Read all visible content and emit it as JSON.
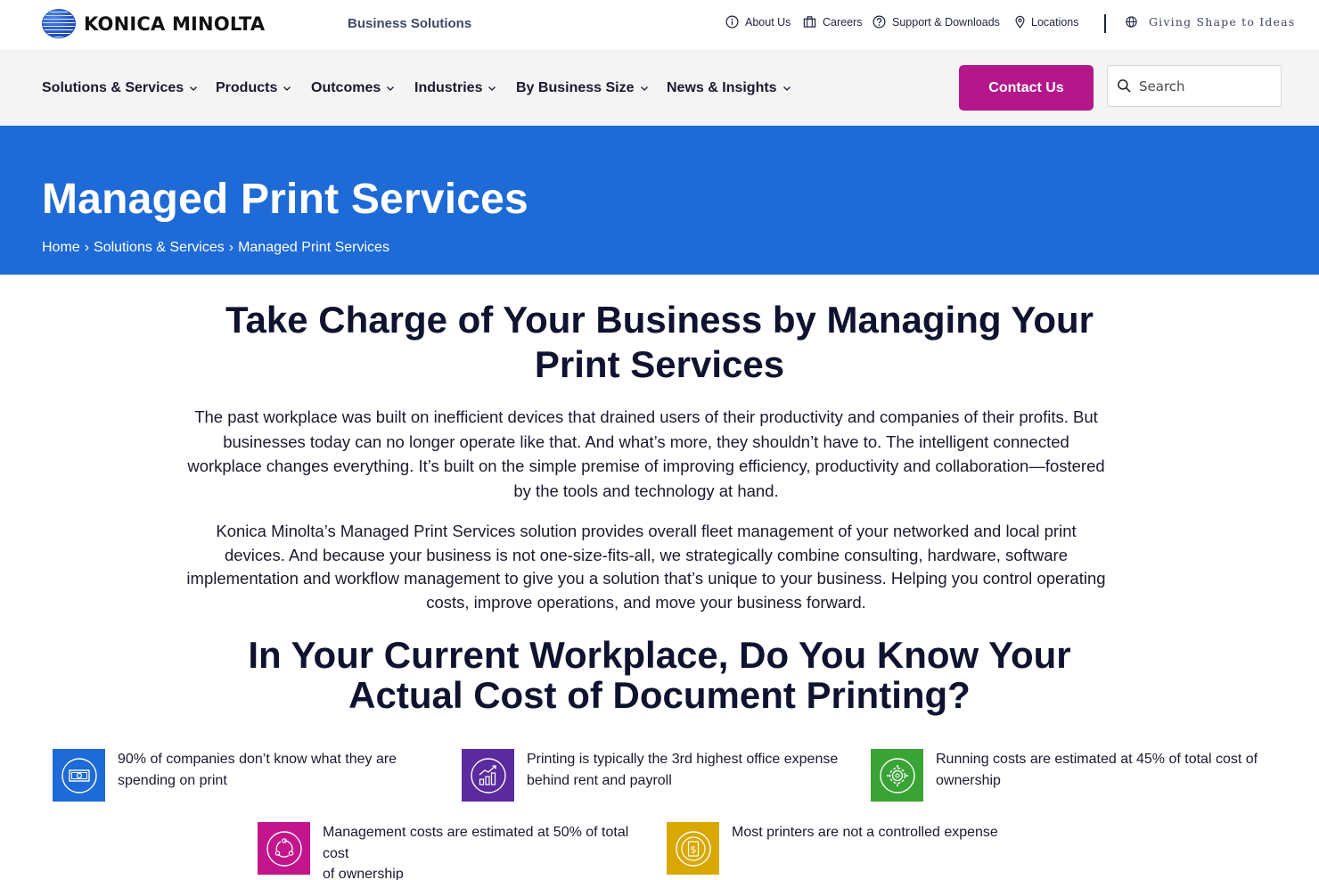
{
  "brand": {
    "logo_text": "KONICA MINOLTA",
    "division": "Business Solutions",
    "tagline": "Giving Shape to Ideas",
    "colors": {
      "primary_blue": "#1e6ad6",
      "accent_magenta": "#b5178a"
    }
  },
  "utility_nav": [
    {
      "label": "About Us",
      "icon": "info-icon"
    },
    {
      "label": "Careers",
      "icon": "briefcase-icon"
    },
    {
      "label": "Support & Downloads",
      "icon": "help-icon"
    },
    {
      "label": "Locations",
      "icon": "location-pin-icon"
    }
  ],
  "main_nav": [
    {
      "label": "Solutions & Services"
    },
    {
      "label": "Products"
    },
    {
      "label": "Outcomes"
    },
    {
      "label": "Industries"
    },
    {
      "label": "By Business Size"
    },
    {
      "label": "News & Insights"
    }
  ],
  "contact_label": "Contact Us",
  "search": {
    "placeholder": "Search"
  },
  "hero": {
    "title": "Managed Print Services",
    "breadcrumb": [
      "Home",
      "Solutions & Services",
      "Managed Print Services"
    ],
    "breadcrumb_separator": "›"
  },
  "section1": {
    "heading_line1": "Take Charge of Your Business by Managing Your",
    "heading_line2": "Print Services",
    "para1_lines": [
      "The past workplace was built on inefficient devices that drained users of their productivity and companies of their profits. But",
      "businesses today can no longer operate like that. And what’s more, they shouldn’t have to. The intelligent connected",
      "workplace changes everything. It’s built on the simple premise of improving efficiency, productivity and collaboration—fostered",
      "by the tools and technology at hand."
    ],
    "para2_lines": [
      "Konica Minolta’s Managed Print Services solution provides overall fleet management of your networked and local print",
      "devices. And because your business is not one-size-fits-all, we strategically combine consulting, hardware, software",
      "implementation and workflow management to give you a solution that’s unique to your business. Helping you control operating",
      "costs, improve operations, and move your business forward."
    ]
  },
  "section2": {
    "heading_line1": "In Your Current Workplace, Do You Know Your",
    "heading_line2": "Actual Cost of Document Printing?"
  },
  "stats": [
    {
      "line1": "90% of companies don’t know what they are",
      "line2": "spending on print",
      "icon": "money-icon",
      "color": "#1e6ad6"
    },
    {
      "line1": "Printing is typically the 3rd highest office expense",
      "line2": "behind rent and payroll",
      "icon": "growth-chart-icon",
      "color": "#5b2a9e"
    },
    {
      "line1": "Running costs are estimated at 45% of total cost of",
      "line2": "ownership",
      "icon": "gear-icon",
      "color": "#3aa336"
    },
    {
      "line1": "Management costs are estimated at 50% of total cost",
      "line2": "of ownership",
      "icon": "cycle-icon",
      "color": "#c4168c"
    },
    {
      "line1": "Most printers are not a controlled expense",
      "line2": "",
      "icon": "dollar-icon",
      "color": "#d9a800"
    }
  ]
}
